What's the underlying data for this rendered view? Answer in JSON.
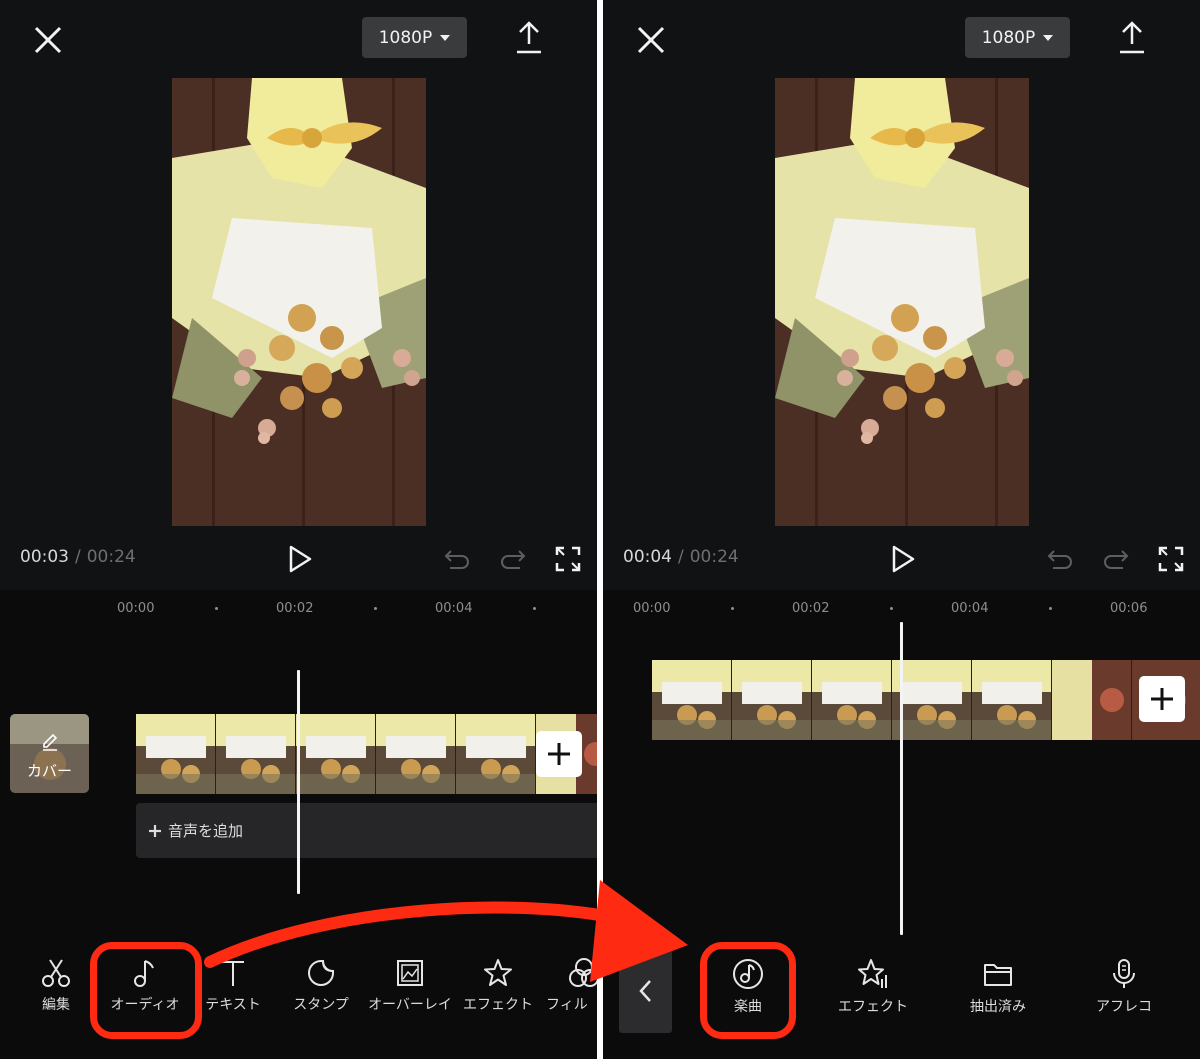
{
  "left_screen": {
    "resolution_label": "1080P",
    "time_current": "00:03",
    "time_separator": "/",
    "time_total": "00:24",
    "ruler_labels": [
      "00:00",
      "00:02",
      "00:04"
    ],
    "cover_label": "カバー",
    "add_audio_label": "音声を追加",
    "toolbar": [
      {
        "label": "編集",
        "icon": "scissors-icon"
      },
      {
        "label": "オーディオ",
        "icon": "music-note-icon"
      },
      {
        "label": "テキスト",
        "icon": "text-icon"
      },
      {
        "label": "スタンプ",
        "icon": "sticker-icon"
      },
      {
        "label": "オーバーレイ",
        "icon": "overlay-icon"
      },
      {
        "label": "エフェクト",
        "icon": "effect-star-icon"
      },
      {
        "label": "フィル",
        "icon": "filter-icon"
      }
    ]
  },
  "right_screen": {
    "resolution_label": "1080P",
    "time_current": "00:04",
    "time_separator": "/",
    "time_total": "00:24",
    "ruler_labels": [
      "00:00",
      "00:02",
      "00:04",
      "00:06"
    ],
    "toolbar": [
      {
        "label": "楽曲",
        "icon": "music-disc-icon"
      },
      {
        "label": "エフェクト",
        "icon": "sound-effect-icon"
      },
      {
        "label": "抽出済み",
        "icon": "folder-icon"
      },
      {
        "label": "アフレコ",
        "icon": "microphone-icon"
      }
    ]
  },
  "annotation": {
    "highlight_color": "#ff2a12"
  }
}
